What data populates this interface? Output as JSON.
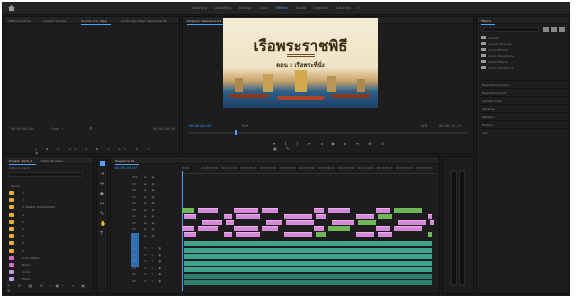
{
  "header": {
    "workspaces": [
      "Learning",
      "Assembly",
      "Editing",
      "Color",
      "Effects",
      "Audio",
      "Graphics",
      "Libraries"
    ],
    "active_workspace": "Effects"
  },
  "source_panel": {
    "tabs": [
      "Effect Controls",
      "Lumetri Scopes",
      "Source: (no clips)",
      "Audio Clip Mixer: Sequence 01"
    ],
    "timecode_left": "00;00;00;00",
    "timecode_mid": "Page 1",
    "timecode_right": "00;00;00;00"
  },
  "program_panel": {
    "tab": "Program: Sequence 01",
    "frame_title": "เรือพระราชพิธี",
    "frame_subtitle": "ตอน : เรือพระที่นั่ง",
    "timecode_left": "00;00;04;07",
    "fit": "Fit",
    "quality": "1/2",
    "timecode_right": "00;06;10;23"
  },
  "effects_panel": {
    "tab": "Effects",
    "items": [
      "Presets",
      "Lumetri Presets",
      "Audio Effects",
      "Audio Transitions",
      "Video Effects",
      "Video Transitions"
    ],
    "sections": [
      "Essential Graphics",
      "Essential Sound",
      "Lumetri Color",
      "Libraries",
      "Markers",
      "History",
      "Info"
    ]
  },
  "project_panel": {
    "tabs": [
      "Project: 2019_1",
      "Media Browser"
    ],
    "path": "2019_1.prproj",
    "column_header": "Name",
    "items": [
      {
        "label": "1",
        "color": "folder"
      },
      {
        "label": "2",
        "color": "folder"
      },
      {
        "label": "3. NARAY KHAOSAMAI",
        "color": "folder"
      },
      {
        "label": "4",
        "color": "folder"
      },
      {
        "label": "5",
        "color": "folder"
      },
      {
        "label": "6",
        "color": "folder"
      },
      {
        "label": "7",
        "color": "folder"
      },
      {
        "label": "8",
        "color": "folder"
      },
      {
        "label": "9",
        "color": "folder"
      },
      {
        "label": "Color Matte",
        "color": "pink"
      },
      {
        "label": "Black",
        "color": "pink"
      },
      {
        "label": "Audio",
        "color": "lav"
      },
      {
        "label": "Music",
        "color": "lav"
      }
    ]
  },
  "timeline": {
    "tab": "Sequence 01",
    "timecode": "00;00;04;07",
    "ruler": [
      "00;00",
      "00;00;30;00",
      "00;01;00;00",
      "00;01;30;00",
      "00;02;00;00",
      "00;02;30;00",
      "00;03;00;00",
      "00;03;30;00",
      "00;04;00;00",
      "00;04;30;00",
      "00;05;00;00",
      "00;05;30;00",
      "00;06;00;00"
    ],
    "video_tracks": [
      "V10",
      "V9",
      "V8",
      "V7",
      "V6",
      "V5",
      "V4",
      "V3",
      "V2",
      "V1"
    ],
    "audio_tracks": [
      "A1",
      "A2",
      "A3",
      "A4",
      "A5",
      "A6"
    ]
  },
  "colors": {
    "accent": "#4ea1ff",
    "video_clip": "#d48ad8",
    "audio_clip": "#3fa28c",
    "folder": "#e8b030"
  }
}
